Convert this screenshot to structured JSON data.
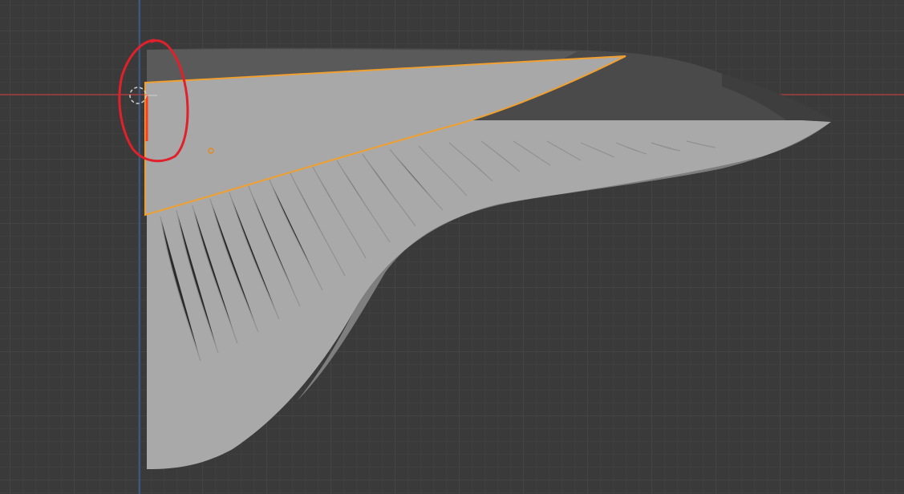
{
  "viewport": {
    "background_color": "#3a3a3a",
    "grid_color": "#444444",
    "x_axis_color": "#a43c3c",
    "z_axis_color": "#3a5f9a"
  },
  "mesh": {
    "fill_color": "#a9a9a9",
    "shadow_color": "#5a5a5a",
    "top_surface_color": "#4a4a4a",
    "rib_color": "#8a8a8a"
  },
  "selected_face": {
    "fill_color": "#a8a8a8",
    "outline_color": "#f0a030",
    "origin_dot_color": "#e08a20"
  },
  "annotation": {
    "circle_color": "#e0202a",
    "highlight_edge_color": "#ff3b20"
  },
  "cursor": {
    "name": "3d-cursor-icon",
    "ring_color": "#d0d0d0"
  }
}
